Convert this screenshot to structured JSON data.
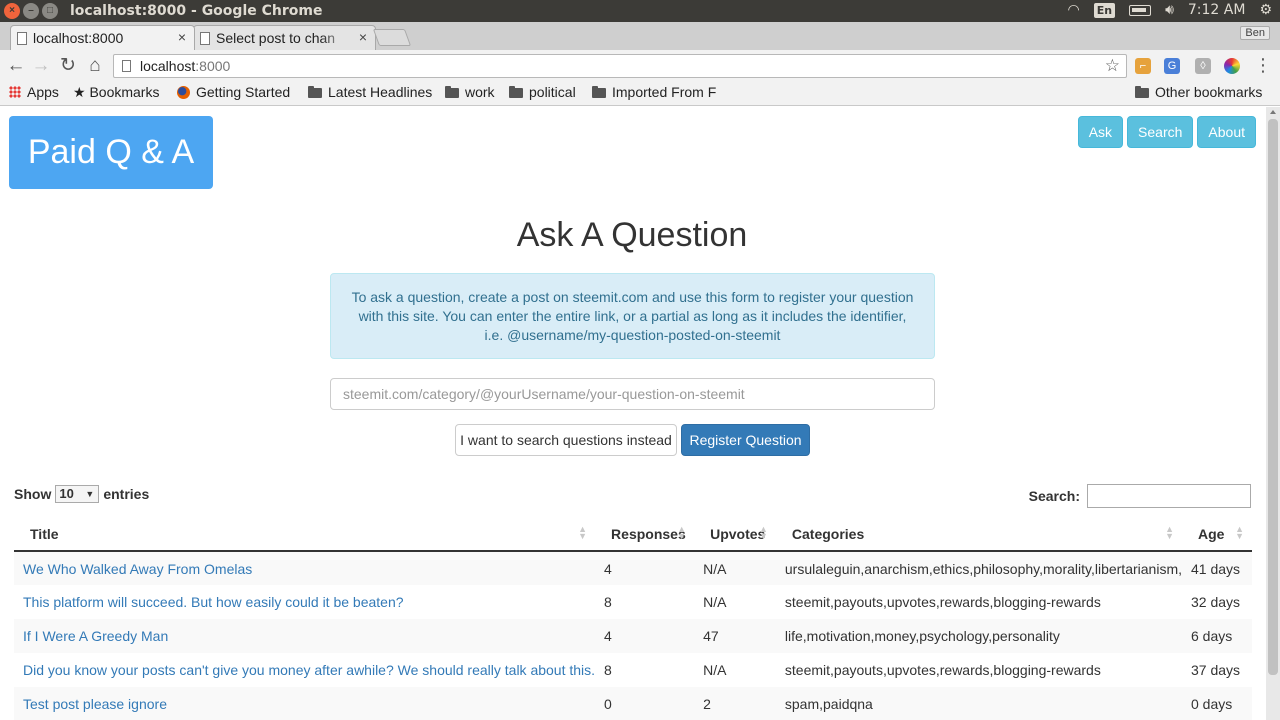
{
  "window": {
    "title": "localhost:8000 - Google Chrome"
  },
  "tray": {
    "lang": "En",
    "time": "7:12 AM"
  },
  "tabs": [
    {
      "label": "localhost:8000"
    },
    {
      "label": "Select post to chan"
    }
  ],
  "profile": "Ben",
  "address_bar": {
    "host": "localhost",
    "port": ":8000"
  },
  "bookmarks": {
    "apps": "Apps",
    "items": [
      "Bookmarks",
      "Getting Started",
      "Latest Headlines",
      "work",
      "political",
      "Imported From F"
    ],
    "other": "Other bookmarks"
  },
  "page": {
    "brand": "Paid Q & A",
    "nav": [
      "Ask",
      "Search",
      "About"
    ],
    "heading": "Ask A Question",
    "info": "To ask a question, create a post on steemit.com and use this form to register your question with this site. You can enter the entire link, or a partial as long as it includes the identifier, i.e. @username/my-question-posted-on-steemit",
    "url_placeholder": "steemit.com/category/@yourUsername/your-question-on-steemit",
    "search_instead_label": "I want to search questions instead",
    "register_label": "Register Question"
  },
  "table": {
    "show_label": "Show",
    "entries_value": "10",
    "entries_label": "entries",
    "search_label": "Search:",
    "columns": [
      "Title",
      "Responses",
      "Upvotes",
      "Categories",
      "Age"
    ],
    "rows": [
      {
        "title": "We Who Walked Away From Omelas",
        "responses": "4",
        "upvotes": "N/A",
        "categories": "ursulaleguin,anarchism,ethics,philosophy,morality,libertarianism,",
        "age": "41 days"
      },
      {
        "title": "This platform will succeed. But how easily could it be beaten?",
        "responses": "8",
        "upvotes": "N/A",
        "categories": "steemit,payouts,upvotes,rewards,blogging-rewards",
        "age": "32 days"
      },
      {
        "title": "If I Were A Greedy Man",
        "responses": "4",
        "upvotes": "47",
        "categories": "life,motivation,money,psychology,personality",
        "age": "6 days"
      },
      {
        "title": "Did you know your posts can't give you money after awhile? We should really talk about this.",
        "responses": "8",
        "upvotes": "N/A",
        "categories": "steemit,payouts,upvotes,rewards,blogging-rewards",
        "age": "37 days"
      },
      {
        "title": "Test post please ignore",
        "responses": "0",
        "upvotes": "2",
        "categories": "spam,paidqna",
        "age": "0 days"
      }
    ]
  },
  "colors": {
    "brand": "#4da6f2",
    "nav_button": "#5bc0de",
    "primary": "#337ab7",
    "info_bg": "#d9edf7",
    "info_text": "#31708f"
  }
}
